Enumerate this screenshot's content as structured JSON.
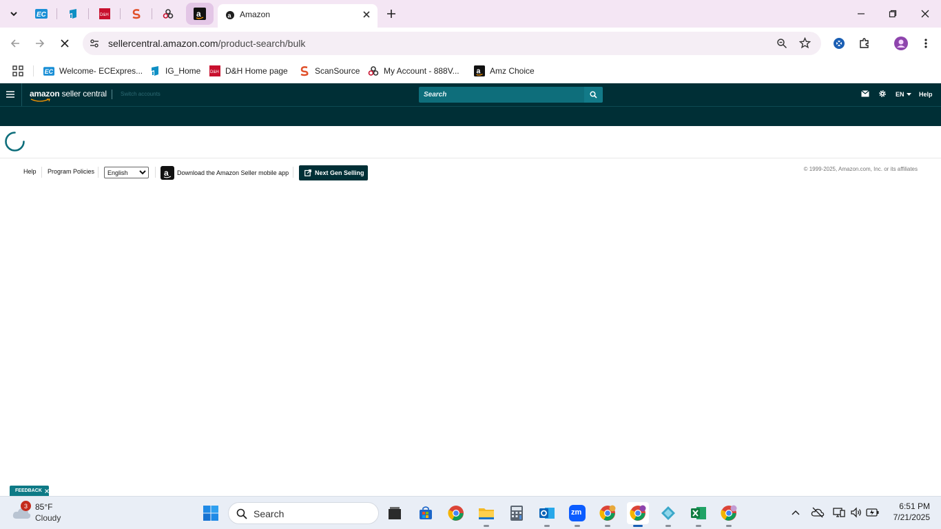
{
  "browser": {
    "active_tab_title": "Amazon",
    "url_host": "sellercentral.amazon.com",
    "url_path": "/product-search/bulk",
    "bookmarks": [
      {
        "label": "Welcome- ECExpres...",
        "icon": "ec-icon"
      },
      {
        "label": "IG_Home",
        "icon": "ig-icon"
      },
      {
        "label": "D&H Home page",
        "icon": "dh-icon"
      },
      {
        "label": "ScanSource",
        "icon": "scansource-icon"
      },
      {
        "label": "My Account - 888V...",
        "icon": "account-icon"
      },
      {
        "label": "Amz Choice",
        "icon": "amazon-icon"
      }
    ],
    "pinned_tabs": [
      "ec-icon",
      "ig-icon",
      "dh-icon",
      "scansource-icon",
      "account-icon",
      "amazon-icon"
    ]
  },
  "seller_central": {
    "logo_text_amazon": "amazon",
    "logo_text_rest": "seller central",
    "switch_accounts": "Switch accounts",
    "search_placeholder": "Search",
    "language": "EN",
    "help": "Help"
  },
  "footer": {
    "help": "Help",
    "program_policies": "Program Policies",
    "language_selected": "English",
    "app_link": "Download the Amazon Seller mobile app",
    "next_gen": "Next Gen Selling",
    "copyright": "© 1999-2025, Amazon.com, Inc. or its affiliates"
  },
  "feedback": "FEEDBACK",
  "taskbar": {
    "weather_temp": "85°F",
    "weather_desc": "Cloudy",
    "weather_badge": "3",
    "search_label": "Search",
    "time": "6:51 PM",
    "date": "7/21/2025",
    "zoom_label": "zm"
  },
  "colors": {
    "seller_header": "#002f36",
    "seller_search": "#0e6e7b",
    "tabstrip": "#f4e6f4"
  }
}
